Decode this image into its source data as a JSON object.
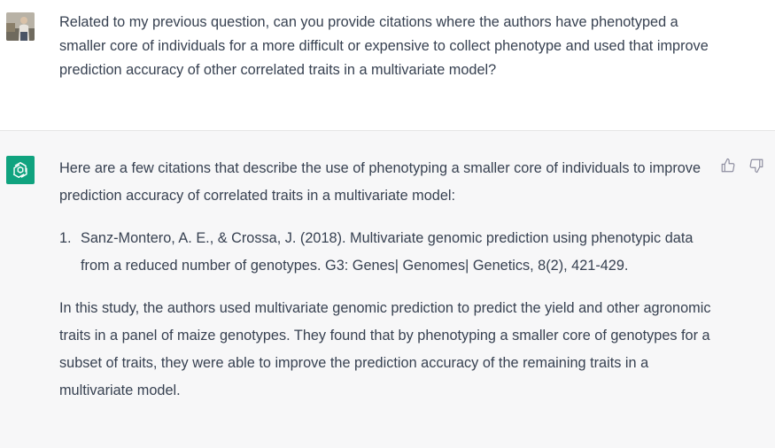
{
  "user_message": {
    "text": "Related to my previous question, can you provide citations where the authors have phenotyped a smaller core of individuals for a more difficult or expensive to collect phenotype and used that improve prediction accuracy of other correlated traits in a multivariate model?"
  },
  "assistant_message": {
    "intro": "Here are a few citations that describe the use of phenotyping a smaller core of individuals to improve prediction accuracy of correlated traits in a multivariate model:",
    "citations": [
      {
        "number": "1.",
        "text": "Sanz-Montero, A. E., & Crossa, J. (2018). Multivariate genomic prediction using phenotypic data from a reduced number of genotypes. G3: Genes| Genomes| Genetics, 8(2), 421-429."
      }
    ],
    "summary": "In this study, the authors used multivariate genomic prediction to predict the yield and other agronomic traits in a panel of maize genotypes. They found that by phenotyping a smaller core of genotypes for a subset of traits, they were able to improve the prediction accuracy of the remaining traits in a multivariate model."
  },
  "colors": {
    "assistant_bg": "#f7f7f8",
    "assistant_avatar": "#10a37f",
    "text": "#374151"
  },
  "icons": {
    "user_avatar": "user-photo-avatar",
    "assistant_avatar": "openai-logo-icon",
    "like": "thumbs-up-icon",
    "dislike": "thumbs-down-icon"
  }
}
